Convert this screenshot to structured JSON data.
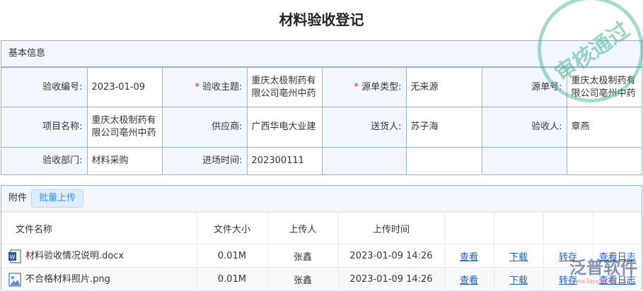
{
  "title": "材料验收登记",
  "stamp": "审核通过",
  "basic": {
    "section": "基本信息",
    "rows": [
      [
        {
          "l": "验收编号:",
          "v": "2023-01-09"
        },
        {
          "l": "验收主题:",
          "v": "重庆太极制药有限公司亳州中药",
          "req": true
        },
        {
          "l": "源单类型:",
          "v": "无来源",
          "req": true
        },
        {
          "l": "源单号:",
          "v": "重庆太极制药有限公司亳州中药"
        }
      ],
      [
        {
          "l": "项目名称:",
          "v": "重庆太极制药有限公司亳州中药"
        },
        {
          "l": "供应商:",
          "v": "广西华电大业建"
        },
        {
          "l": "送货人:",
          "v": "苏子海"
        },
        {
          "l": "验收人:",
          "v": "章燕"
        }
      ],
      [
        {
          "l": "验收部门:",
          "v": "材料采购"
        },
        {
          "l": "进场时间:",
          "v": "202300111"
        },
        {
          "l": "",
          "v": ""
        },
        {
          "l": "",
          "v": ""
        }
      ]
    ]
  },
  "attach": {
    "section": "附件",
    "upload": "批量上传",
    "headers": [
      "文件名称",
      "文件大小",
      "上传人",
      "上传时间"
    ],
    "files": [
      {
        "name": "材料验收情况说明.docx",
        "icon": "word-file-icon",
        "size": "0.01M",
        "user": "张鑫",
        "time": "2023-01-09 14:26"
      },
      {
        "name": "不合格材料照片.png",
        "icon": "image-file-icon",
        "size": "0.01M",
        "user": "张鑫",
        "time": "2023-01-09 14:26"
      }
    ],
    "actions": [
      "查看",
      "下载",
      "转存",
      "查看日志"
    ]
  },
  "watermark": {
    "brand": "泛普软件",
    "url": "www.fanpusoft.com"
  }
}
